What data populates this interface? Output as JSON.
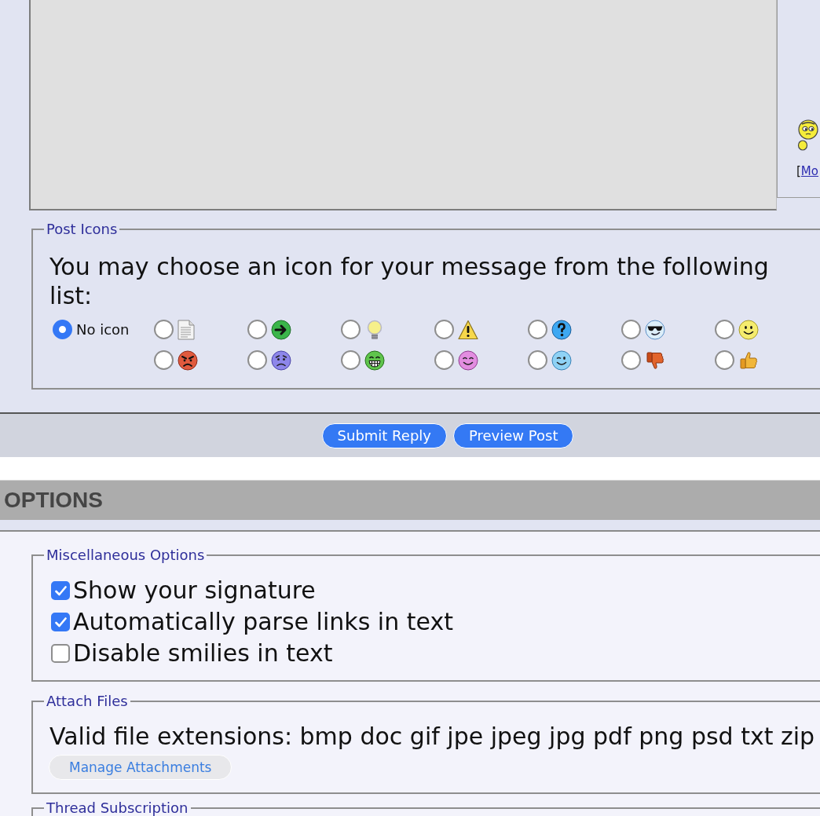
{
  "editor": {
    "smilies_panel": {
      "bracket": "[",
      "link": "Mo"
    }
  },
  "post_icons": {
    "legend": "Post Icons",
    "prompt": "You may choose an icon for your message from the following list:",
    "no_icon": {
      "label": "No icon",
      "selected": true
    },
    "icons": [
      {
        "selected": false
      },
      {
        "selected": false
      },
      {
        "selected": false
      },
      {
        "selected": false
      },
      {
        "selected": false
      },
      {
        "selected": false
      },
      {
        "selected": false
      },
      {
        "selected": false
      },
      {
        "selected": false
      },
      {
        "selected": false
      },
      {
        "selected": false
      },
      {
        "selected": false
      },
      {
        "selected": false
      },
      {
        "selected": false
      }
    ]
  },
  "actions": {
    "buttons": [
      "Submit Reply",
      "Preview Post"
    ]
  },
  "options": {
    "title": "OPTIONS",
    "misc": {
      "legend": "Miscellaneous Options",
      "checkboxes": [
        {
          "label": "Show your signature",
          "checked": true
        },
        {
          "label": "Automatically parse links in text",
          "checked": true
        },
        {
          "label": "Disable smilies in text",
          "checked": false
        }
      ]
    },
    "attach": {
      "legend": "Attach Files",
      "extensions": "Valid file extensions: bmp doc gif jpe jpeg jpg pdf png psd txt zip",
      "button": "Manage Attachments"
    },
    "subscription": {
      "legend": "Thread Subscription"
    }
  }
}
